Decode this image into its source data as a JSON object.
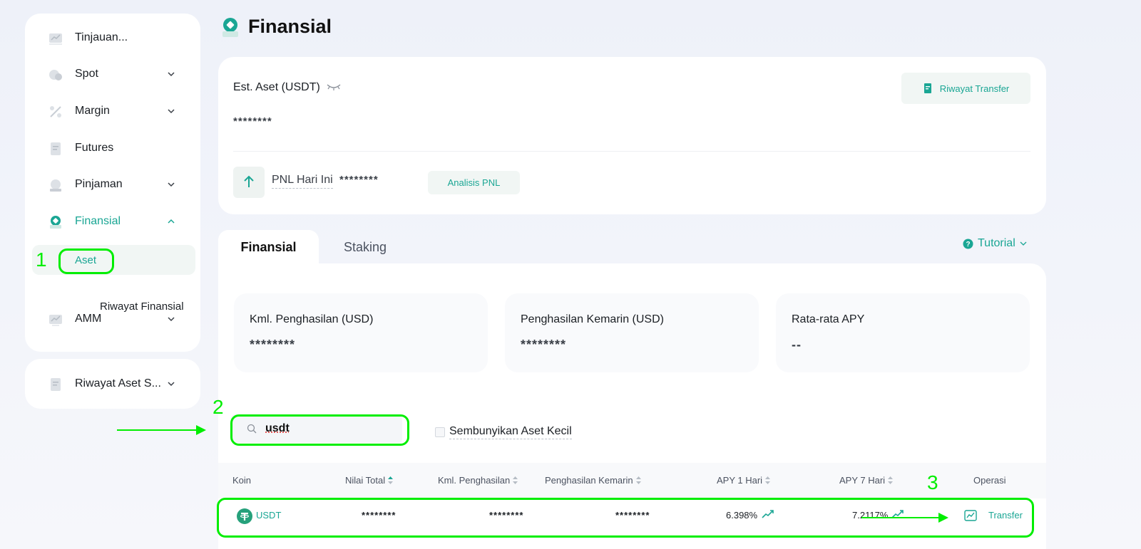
{
  "sidebar": {
    "items": [
      {
        "label": "Tinjauan...",
        "icon": "overview-icon",
        "has_chevron": false
      },
      {
        "label": "Spot",
        "icon": "spot-icon",
        "has_chevron": true
      },
      {
        "label": "Margin",
        "icon": "margin-icon",
        "has_chevron": true
      },
      {
        "label": "Futures",
        "icon": "futures-icon",
        "has_chevron": false
      },
      {
        "label": "Pinjaman",
        "icon": "loan-icon",
        "has_chevron": true
      },
      {
        "label": "Finansial",
        "icon": "finance-icon",
        "has_chevron": true,
        "active": true
      },
      {
        "label": "AMM",
        "icon": "amm-icon",
        "has_chevron": true
      }
    ],
    "sub_items": [
      {
        "label": "Aset",
        "active": true
      },
      {
        "label": "Riwayat Finansial",
        "active": false
      }
    ],
    "history": {
      "label": "Riwayat Aset S...",
      "icon": "history-icon"
    }
  },
  "header": {
    "title": "Finansial"
  },
  "summary": {
    "est_label": "Est. Aset (USDT)",
    "est_value": "********",
    "riwayat_transfer": "Riwayat Transfer",
    "pnl_label": "PNL Hari Ini",
    "pnl_value": "********",
    "analisis_pnl": "Analisis PNL"
  },
  "tabs": [
    {
      "label": "Finansial",
      "active": true
    },
    {
      "label": "Staking",
      "active": false
    }
  ],
  "tutorial": "Tutorial",
  "stats": [
    {
      "label": "Kml. Penghasilan (USD)",
      "value": "********"
    },
    {
      "label": "Penghasilan Kemarin (USD)",
      "value": "********"
    },
    {
      "label": "Rata-rata APY",
      "value": "--"
    }
  ],
  "search": {
    "value": "usdt"
  },
  "hide_small": {
    "label": "Sembunyikan Aset Kecil",
    "checked": false
  },
  "table": {
    "columns": [
      "Koin",
      "Nilai Total",
      "Kml. Penghasilan",
      "Penghasilan Kemarin",
      "APY 1 Hari",
      "APY 7 Hari",
      "Operasi"
    ],
    "rows": [
      {
        "coin": "USDT",
        "total": "********",
        "earnings": "********",
        "yesterday": "********",
        "apy1": "6.398%",
        "apy7": "7.2117%",
        "operation": "Transfer"
      }
    ]
  },
  "annotations": [
    "1",
    "2",
    "3"
  ],
  "colors": {
    "accent": "#1aa694",
    "annotation": "#00ee00"
  }
}
